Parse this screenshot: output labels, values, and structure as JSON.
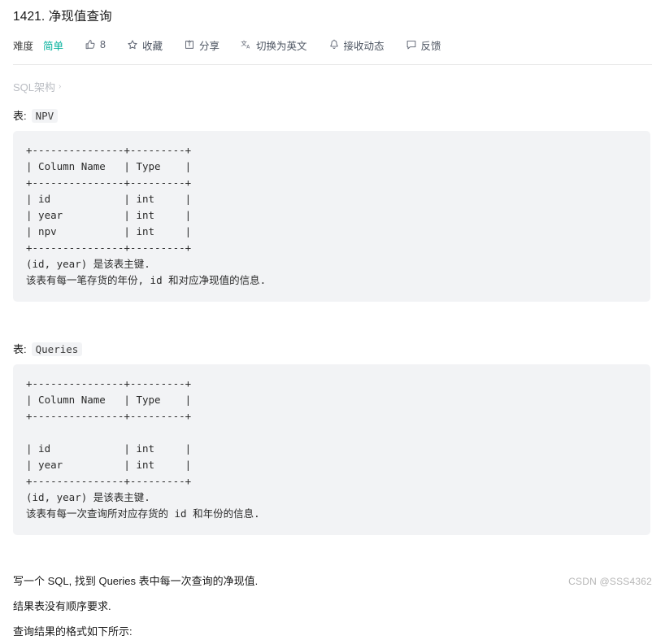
{
  "page": {
    "title": "1421. 净现值查询",
    "watermark": "CSDN @SSS4362"
  },
  "toolbar": {
    "difficulty_label": "难度",
    "difficulty_value": "简单",
    "like_count": "8",
    "favorite_label": "收藏",
    "share_label": "分享",
    "translate_label": "切换为英文",
    "subscribe_label": "接收动态",
    "feedback_label": "反馈"
  },
  "breadcrumb": {
    "label": "SQL架构",
    "chevron": "›"
  },
  "sections": [
    {
      "table_label": "表:",
      "table_name": "NPV",
      "code": "+---------------+---------+\n| Column Name   | Type    |\n+---------------+---------+\n| id            | int     |\n| year          | int     |\n| npv           | int     |\n+---------------+---------+\n(id, year) 是该表主键.\n该表有每一笔存货的年份, id 和对应净现值的信息."
    },
    {
      "table_label": "表:",
      "table_name": "Queries",
      "code": "+---------------+---------+\n| Column Name   | Type    |\n+---------------+---------+\n\n| id            | int     |\n| year          | int     |\n+---------------+---------+\n(id, year) 是该表主键.\n该表有每一次查询所对应存货的 id 和年份的信息."
    }
  ],
  "paragraphs": [
    "写一个 SQL, 找到 Queries 表中每一次查询的净现值.",
    "结果表没有顺序要求.",
    "查询结果的格式如下所示:"
  ],
  "colors": {
    "accent_green": "#00af9b",
    "code_bg": "#f2f3f5",
    "divider": "#e6e6e6",
    "muted": "#b9bcc2"
  }
}
